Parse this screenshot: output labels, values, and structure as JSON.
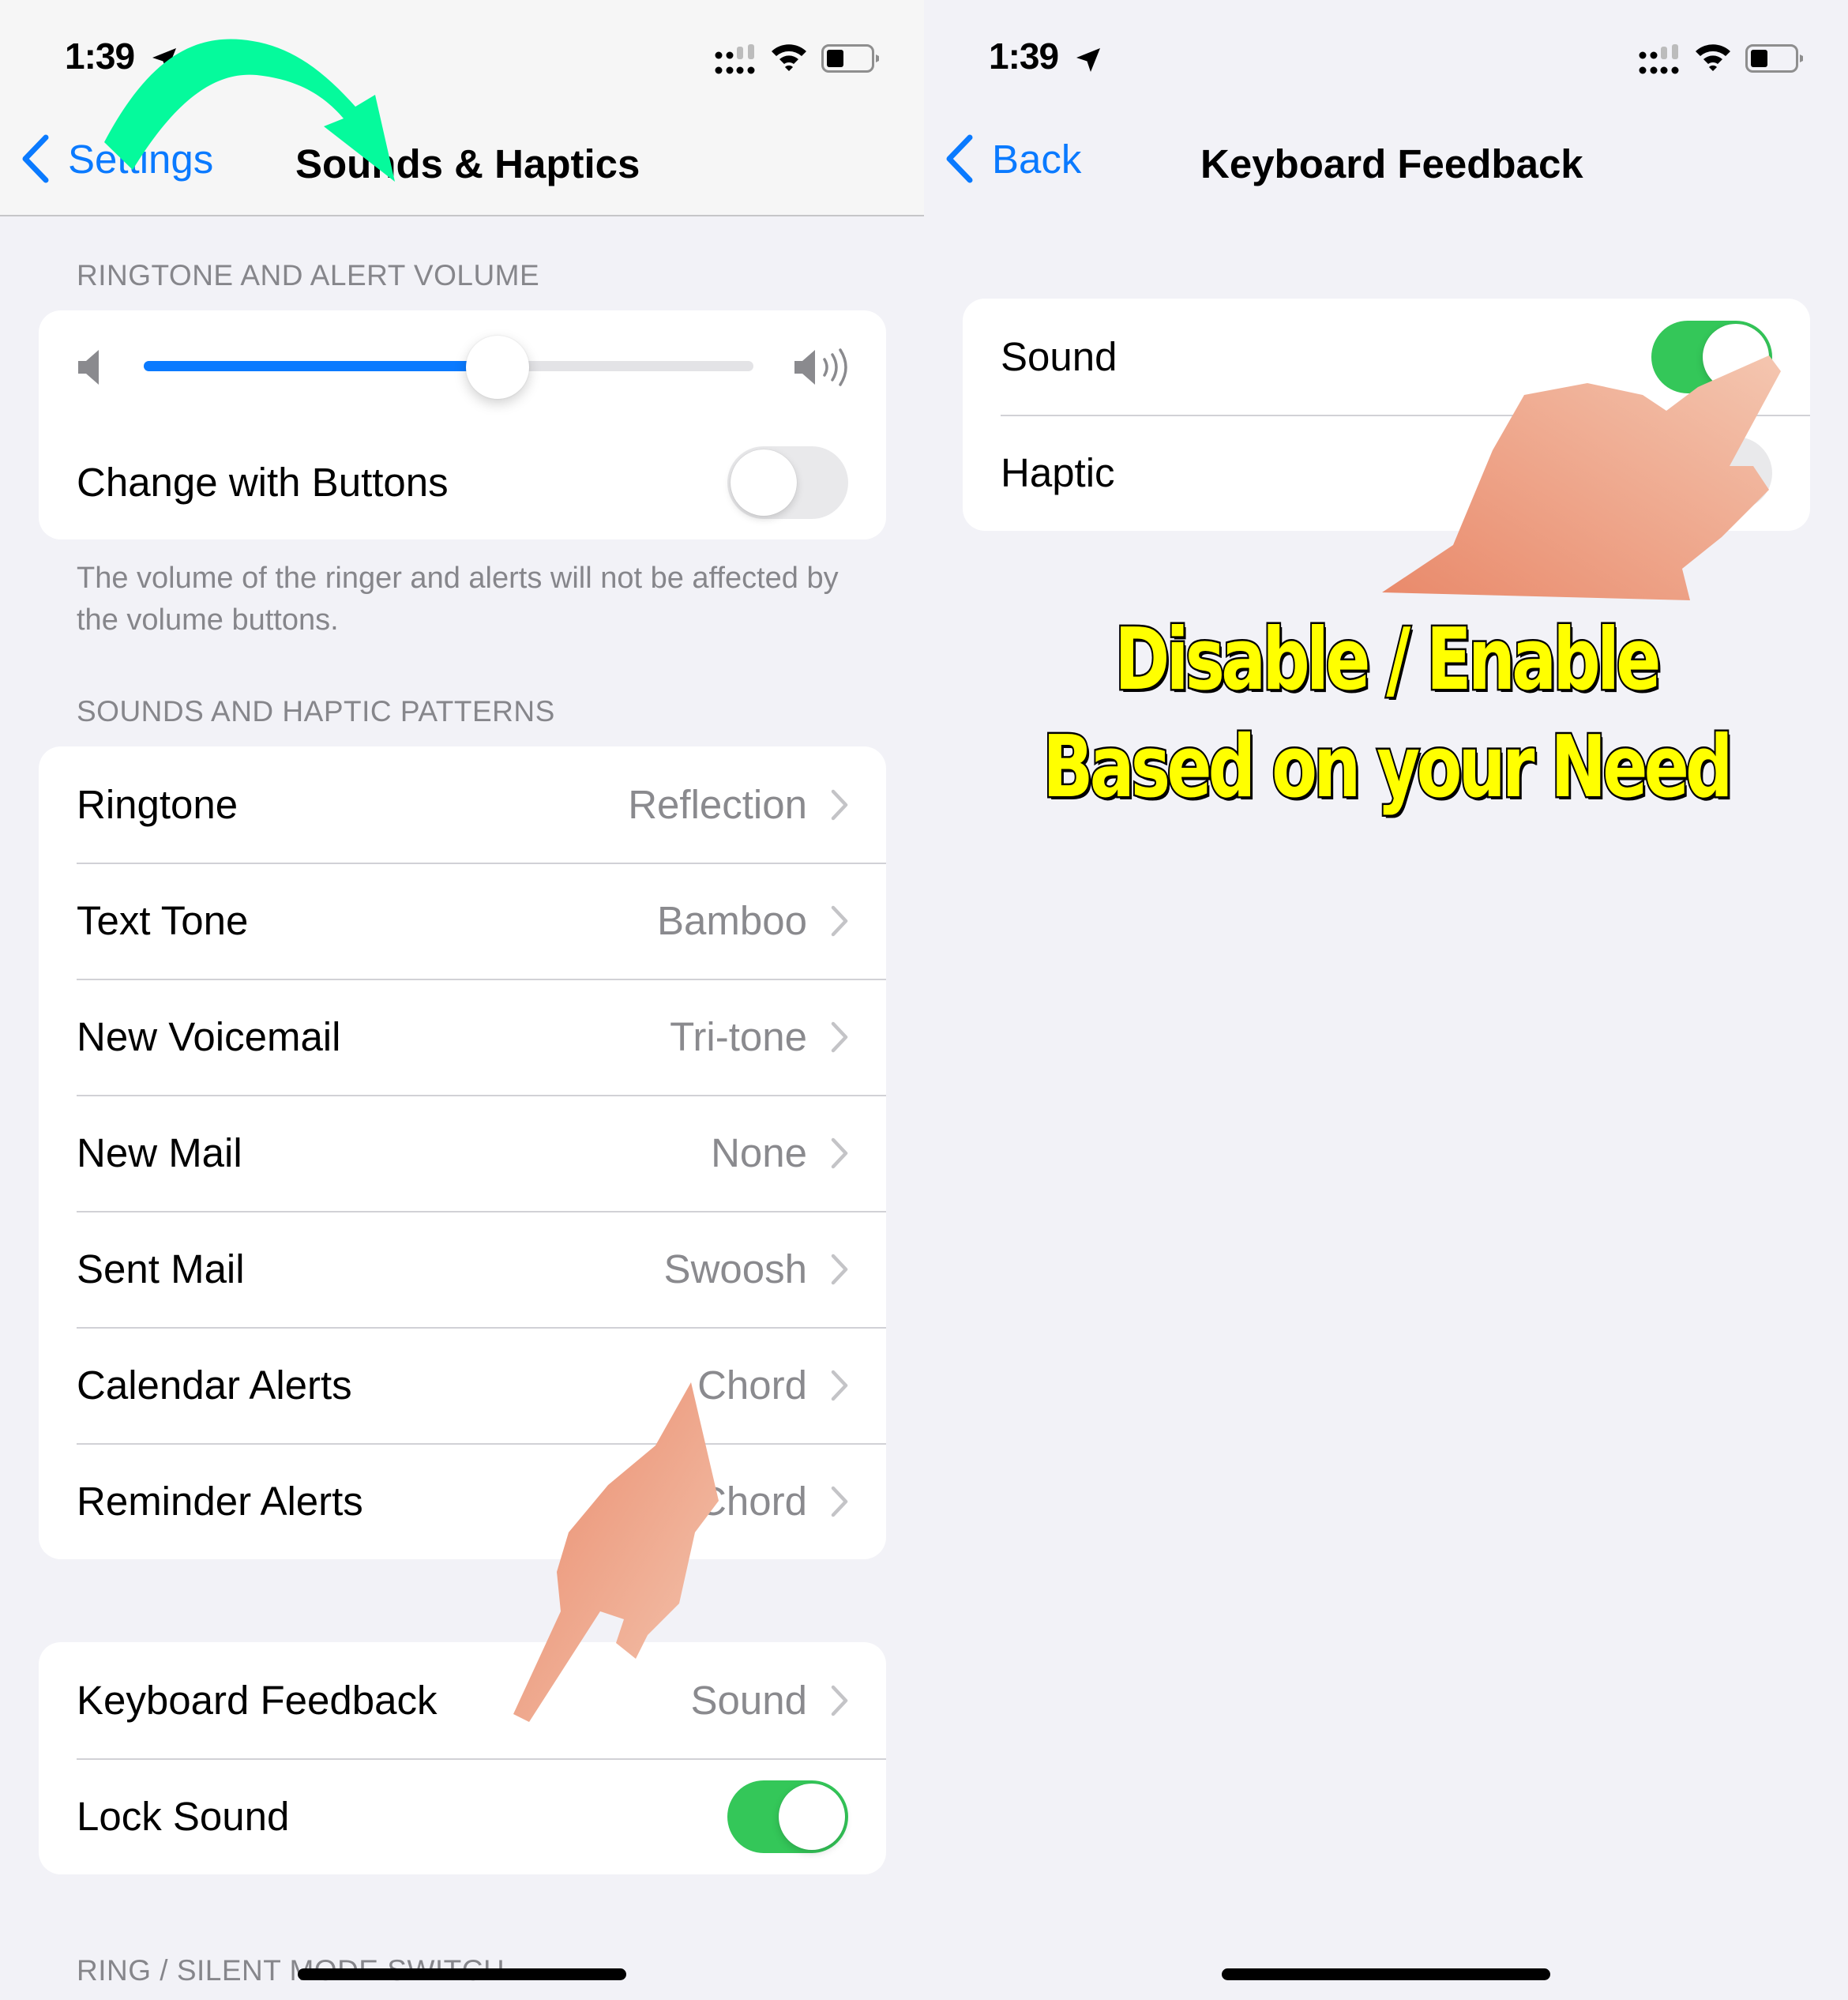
{
  "left_screen": {
    "status_bar": {
      "time": "1:39",
      "icons": [
        "location-arrow-icon",
        "signal-icon",
        "wifi-icon",
        "battery-icon"
      ]
    },
    "nav": {
      "back_label": "Settings",
      "title": "Sounds & Haptics"
    },
    "volume_section": {
      "header": "RINGTONE AND ALERT VOLUME",
      "volume_level_percent": 58,
      "change_with_buttons": {
        "label": "Change with Buttons",
        "on": false
      },
      "footer": "The volume of the ringer and alerts will not be affected by the volume buttons."
    },
    "patterns_section": {
      "header": "SOUNDS AND HAPTIC PATTERNS",
      "rows": [
        {
          "label": "Ringtone",
          "value": "Reflection"
        },
        {
          "label": "Text Tone",
          "value": "Bamboo"
        },
        {
          "label": "New Voicemail",
          "value": "Tri-tone"
        },
        {
          "label": "New Mail",
          "value": "None"
        },
        {
          "label": "Sent Mail",
          "value": "Swoosh"
        },
        {
          "label": "Calendar Alerts",
          "value": "Chord"
        },
        {
          "label": "Reminder Alerts",
          "value": "Chord"
        }
      ]
    },
    "system_section": {
      "keyboard_feedback": {
        "label": "Keyboard Feedback",
        "value": "Sound"
      },
      "lock_sound": {
        "label": "Lock Sound",
        "on": true
      }
    },
    "next_header": "RING / SILENT MODE SWITCH"
  },
  "right_screen": {
    "status_bar": {
      "time": "1:39"
    },
    "nav": {
      "back_label": "Back",
      "title": "Keyboard Feedback"
    },
    "options": [
      {
        "label": "Sound",
        "on": true
      },
      {
        "label": "Haptic",
        "on": false
      }
    ]
  },
  "annotations": {
    "caption_line1": "Disable / Enable",
    "caption_line2": "Based on your Need",
    "arrow_color": "#05fa9c",
    "caption_color": "#ffff00"
  },
  "colors": {
    "accent_blue": "#0a7aff",
    "toggle_green": "#34c759",
    "background": "#f2f2f7"
  }
}
